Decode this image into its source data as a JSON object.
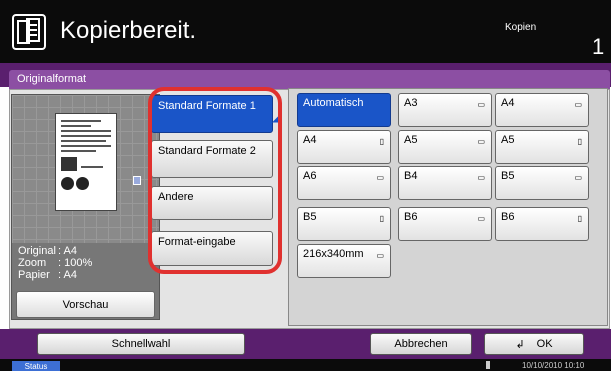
{
  "header": {
    "title": "Kopierbereit.",
    "mode": "Kopien",
    "copy_count": "1"
  },
  "panel": {
    "title": "Originalformat"
  },
  "preview": {
    "info": [
      {
        "key": "Original",
        "value": ": A4"
      },
      {
        "key": "Zoom",
        "value": ": 100%"
      },
      {
        "key": "Papier",
        "value": ": A4"
      }
    ],
    "button": "Vorschau"
  },
  "categories": [
    {
      "label": "Standard Formate 1",
      "selected": true
    },
    {
      "label": "Standard Formate 2",
      "selected": false
    },
    {
      "label": "Andere",
      "selected": false
    },
    {
      "label": "Format-eingabe",
      "selected": false
    }
  ],
  "sizes": [
    {
      "label": "Automatisch",
      "orient": "",
      "selected": true
    },
    {
      "label": "A3",
      "orient": "landscape",
      "selected": false
    },
    {
      "label": "A4",
      "orient": "landscape",
      "selected": false
    },
    {
      "label": "A4",
      "orient": "portrait",
      "selected": false
    },
    {
      "label": "A5",
      "orient": "landscape",
      "selected": false
    },
    {
      "label": "A5",
      "orient": "portrait",
      "selected": false
    },
    {
      "label": "A6",
      "orient": "landscape",
      "selected": false
    },
    {
      "label": "B4",
      "orient": "landscape",
      "selected": false
    },
    {
      "label": "B5",
      "orient": "landscape",
      "selected": false
    },
    {
      "label": "B5",
      "orient": "portrait",
      "selected": false
    },
    {
      "label": "B6",
      "orient": "landscape",
      "selected": false
    },
    {
      "label": "B6",
      "orient": "portrait",
      "selected": false
    },
    {
      "label": "216x340mm",
      "orient": "landscape",
      "selected": false
    }
  ],
  "footer": {
    "quick": "Schnellwahl",
    "cancel": "Abbrechen",
    "ok": "OK"
  },
  "status": {
    "label": "Status",
    "datetime": "10/10/2010  10:10"
  },
  "colors": {
    "accent": "#1a55c8",
    "band": "#5a1f6e",
    "highlight": "#e0312f"
  }
}
